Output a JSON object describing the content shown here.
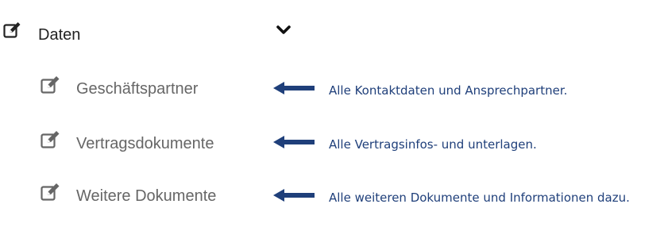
{
  "menu": {
    "main_item": {
      "label": "Daten",
      "icon": "edit-icon",
      "toggle_icon": "chevron-down-icon"
    },
    "sub_items": [
      {
        "label": "Geschäftspartner",
        "icon": "edit-icon",
        "note": "Alle Kontaktdaten und Ansprechpartner."
      },
      {
        "label": "Vertragsdokumente",
        "icon": "edit-icon",
        "note": "Alle Vertragsinfos- und unterlagen."
      },
      {
        "label": "Weitere Dokumente",
        "icon": "edit-icon",
        "note": "Alle weiteren Dokumente und Informationen dazu."
      }
    ]
  },
  "colors": {
    "main_text": "#222222",
    "sub_text": "#666666",
    "icon_dark": "#222222",
    "icon_gray": "#666666",
    "annotation": "#1f3f7a"
  }
}
